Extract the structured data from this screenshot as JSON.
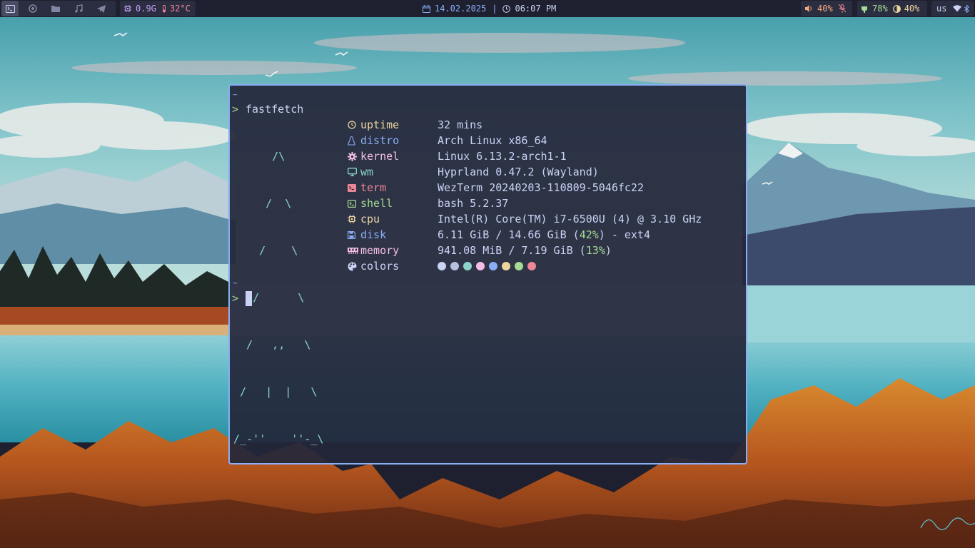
{
  "topbar": {
    "left": {
      "workspace_icons": [
        "terminal-icon",
        "browser-icon",
        "folder-icon",
        "music-icon",
        "telegram-icon"
      ],
      "memory": "0.9G",
      "temperature": "32°C"
    },
    "center": {
      "date": "14.02.2025",
      "separator": "|",
      "time": "06:07 PM"
    },
    "right": {
      "volume": "40%",
      "battery": "78%",
      "brightness": "40%",
      "keyboard_layout": "us"
    },
    "colors": {
      "bar": "#1e2030",
      "group": "#2b2e40",
      "text": "#cad3f5"
    }
  },
  "terminal": {
    "tilde": "~",
    "prompt": ">",
    "command": "fastfetch",
    "logo_lines": [
      "      /\\",
      "     /  \\",
      "    /    \\",
      "   /      \\",
      "  /   ,,   \\",
      " /   |  |   \\",
      "/_-''    ''-_\\"
    ],
    "info": [
      {
        "key": "uptime",
        "value": "32 mins",
        "icon": "clock-icon",
        "color": "#eed49f"
      },
      {
        "key": "distro",
        "value": "Arch Linux x86_64",
        "icon": "linux-icon",
        "color": "#8aadf4"
      },
      {
        "key": "kernel",
        "value": "Linux 6.13.2-arch1-1",
        "icon": "gear-icon",
        "color": "#f5bde6"
      },
      {
        "key": "wm",
        "value": "Hyprland 0.47.2 (Wayland)",
        "icon": "monitor-icon",
        "color": "#8bd5ca"
      },
      {
        "key": "term",
        "value": "WezTerm 20240203-110809-5046fc22",
        "icon": "terminal-icon",
        "color": "#ed8796"
      },
      {
        "key": "shell",
        "value": "bash 5.2.37",
        "icon": "shell-icon",
        "color": "#a6da95"
      },
      {
        "key": "cpu",
        "value": "Intel(R) Core(TM) i7-6500U (4) @ 3.10 GHz",
        "icon": "cpu-icon",
        "color": "#eed49f"
      },
      {
        "key": "disk",
        "value_pre": "6.11 GiB / 14.66 GiB (",
        "value_pct": "42%",
        "value_post": ") - ext4",
        "icon": "save-icon",
        "color": "#8aadf4"
      },
      {
        "key": "memory",
        "value_pre": "941.08 MiB / 7.19 GiB (",
        "value_pct": "13%",
        "value_post": ")",
        "icon": "memory-icon",
        "color": "#f5bde6"
      },
      {
        "key": "colors",
        "icon": "palette-icon",
        "color": "#cad3f5"
      }
    ],
    "palette": [
      "#cad3f5",
      "#b8c0e0",
      "#8bd5ca",
      "#f5bde6",
      "#8aadf4",
      "#eed49f",
      "#a6da95",
      "#ed8796"
    ],
    "colors": {
      "border": "#8aadf4",
      "foreground": "#cad3f5",
      "prompt": "#a6da95",
      "logo": "#8bd5ca"
    }
  }
}
